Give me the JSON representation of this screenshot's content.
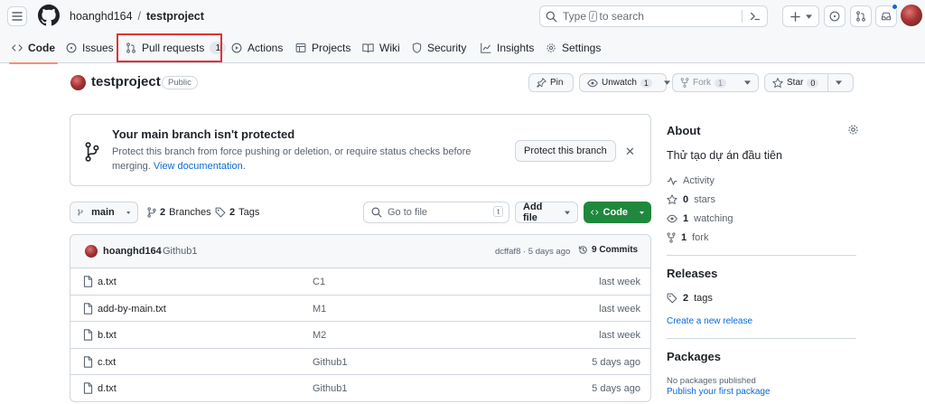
{
  "header": {
    "owner": "hoanghd164",
    "separator": "/",
    "repo": "testproject",
    "search_prefix": "Type",
    "search_key": "/",
    "search_suffix": "to search"
  },
  "tabs": [
    {
      "label": "Code",
      "active": true
    },
    {
      "label": "Issues"
    },
    {
      "label": "Pull requests",
      "count": "1"
    },
    {
      "label": "Actions"
    },
    {
      "label": "Projects"
    },
    {
      "label": "Wiki"
    },
    {
      "label": "Security"
    },
    {
      "label": "Insights"
    },
    {
      "label": "Settings"
    }
  ],
  "repo": {
    "name": "testproject",
    "visibility": "Public",
    "pin": "Pin",
    "unwatch": "Unwatch",
    "unwatch_count": "1",
    "fork": "Fork",
    "fork_count": "1",
    "star": "Star",
    "star_count": "0"
  },
  "banner": {
    "title": "Your main branch isn't protected",
    "desc": "Protect this branch from force pushing or deletion, or require status checks before merging.",
    "link": "View documentation.",
    "button": "Protect this branch"
  },
  "toolbar": {
    "branch": "main",
    "branches_count": "2",
    "branches_label": "Branches",
    "tags_count": "2",
    "tags_label": "Tags",
    "go_to_file": "Go to file",
    "go_key": "t",
    "add_file": "Add file",
    "code": "Code"
  },
  "latest_commit": {
    "author": "hoanghd164",
    "message": "Github1",
    "hash_time": "dcffaf8 · 5 days ago",
    "commits": "9 Commits"
  },
  "files": [
    {
      "name": "a.txt",
      "message": "C1",
      "time": "last week"
    },
    {
      "name": "add-by-main.txt",
      "message": "M1",
      "time": "last week"
    },
    {
      "name": "b.txt",
      "message": "M2",
      "time": "last week"
    },
    {
      "name": "c.txt",
      "message": "Github1",
      "time": "5 days ago"
    },
    {
      "name": "d.txt",
      "message": "Github1",
      "time": "5 days ago"
    }
  ],
  "about": {
    "title": "About",
    "description": "Thử tạo dự án đầu tiên",
    "activity": "Activity",
    "stars_count": "0",
    "stars_label": "stars",
    "watching_count": "1",
    "watching_label": "watching",
    "fork_count": "1",
    "fork_label": "fork"
  },
  "releases": {
    "title": "Releases",
    "tags_count": "2",
    "tags_label": "tags",
    "create_link": "Create a new release"
  },
  "packages": {
    "title": "Packages",
    "none": "No packages published",
    "publish_link": "Publish your first package"
  },
  "colors": {
    "accent_green": "#1f883d",
    "link_blue": "#0969da",
    "tab_underline": "#fd8c73",
    "highlight_red": "#e03232"
  }
}
